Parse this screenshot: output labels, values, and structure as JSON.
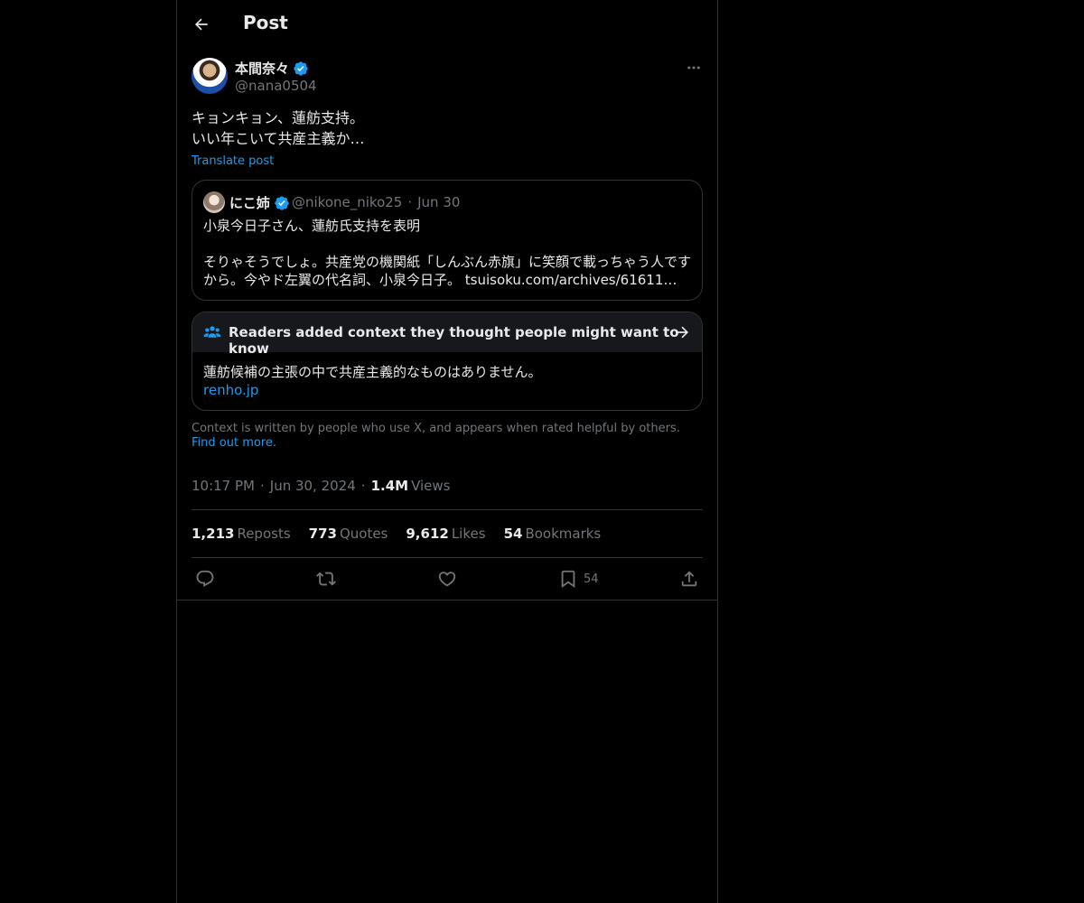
{
  "header": {
    "title": "Post"
  },
  "post": {
    "author_name": "本間奈々",
    "author_handle": "@nana0504",
    "text": "キョンキョン、蓮舫支持。\nいい年こいて共産主義か…",
    "translate_label": "Translate post"
  },
  "quote": {
    "name": "にこ姉",
    "handle": "@nikone_niko25",
    "separator": "·",
    "date": "Jun 30",
    "line1": "小泉今日子さん、蓮舫氏支持を表明",
    "line2": "そりゃそうでしょ。共産党の機関紙「しんぶん赤旗」に笑顔で載っちゃう人です",
    "line3_prefix": "から。今やド左翼の代名詞、小泉今日子。",
    "line3_link": "tsuisoku.com/archives/61611…"
  },
  "community_note": {
    "title": "Readers added context they thought people might want to know",
    "body": "蓮舫候補の主張の中で共産主義的なものはありません。",
    "link": "renho.jp",
    "footer": "Context is written by people who use X, and appears when rated helpful by others.",
    "footer_link": "Find out more."
  },
  "meta": {
    "time": "10:17 PM",
    "date": "Jun 30, 2024",
    "separator": "·",
    "views_count": "1.4M",
    "views_label": "Views"
  },
  "stats": {
    "reposts_count": "1,213",
    "reposts_label": "Reposts",
    "quotes_count": "773",
    "quotes_label": "Quotes",
    "likes_count": "9,612",
    "likes_label": "Likes",
    "bookmarks_count": "54",
    "bookmarks_label": "Bookmarks"
  },
  "actions": {
    "bookmark_count": "54"
  },
  "colors": {
    "background": "#000000",
    "accent": "#1d9bf0",
    "text_primary": "#e7e9ea",
    "text_secondary": "#71767b",
    "border": "#2f3336"
  },
  "icons": {
    "back": "arrow-left-icon",
    "verified": "verified-badge-icon",
    "more": "more-horizontal-icon",
    "people": "people-icon",
    "arrow": "arrow-right-icon",
    "reply": "reply-icon",
    "repost": "repost-icon",
    "like": "heart-icon",
    "bookmark": "bookmark-icon",
    "share": "share-icon"
  }
}
